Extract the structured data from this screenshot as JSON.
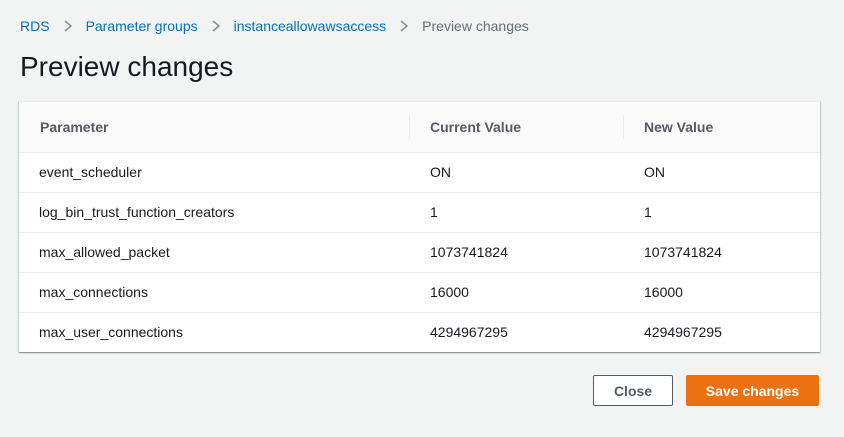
{
  "breadcrumb": {
    "items": [
      "RDS",
      "Parameter groups",
      "instanceallowawsaccess"
    ],
    "current": "Preview changes"
  },
  "page_title": "Preview changes",
  "table": {
    "headers": [
      "Parameter",
      "Current Value",
      "New Value"
    ],
    "rows": [
      [
        "event_scheduler",
        "ON",
        "ON"
      ],
      [
        "log_bin_trust_function_creators",
        "1",
        "1"
      ],
      [
        "max_allowed_packet",
        "1073741824",
        "1073741824"
      ],
      [
        "max_connections",
        "16000",
        "16000"
      ],
      [
        "max_user_connections",
        "4294967295",
        "4294967295"
      ]
    ]
  },
  "buttons": {
    "close_label": "Close",
    "save_label": "Save changes"
  },
  "colors": {
    "link": "#0073bb",
    "primary": "#ec7211",
    "background": "#f2f3f3"
  },
  "icons": {
    "separator": "chevron-right-icon"
  }
}
